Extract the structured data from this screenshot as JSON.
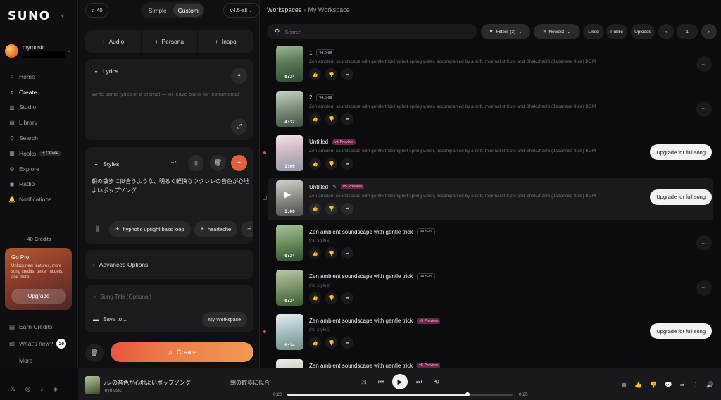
{
  "sidebar": {
    "logo": "SUNO",
    "user": {
      "name": "mymusic"
    },
    "nav": [
      {
        "label": "Home",
        "icon": "home-icon",
        "glyph": "⌂"
      },
      {
        "label": "Create",
        "icon": "music-note-icon",
        "glyph": "♫",
        "active": true
      },
      {
        "label": "Studio",
        "icon": "studio-icon",
        "glyph": "▥"
      },
      {
        "label": "Library",
        "icon": "library-icon",
        "glyph": "▤"
      },
      {
        "label": "Search",
        "icon": "search-icon",
        "glyph": "⚲"
      },
      {
        "label": "Hooks",
        "icon": "hooks-icon",
        "glyph": "▦",
        "badge": "+ Create"
      },
      {
        "label": "Explore",
        "icon": "explore-icon",
        "glyph": "◎"
      },
      {
        "label": "Radio",
        "icon": "radio-icon",
        "glyph": "◉"
      },
      {
        "label": "Notifications",
        "icon": "bell-icon",
        "glyph": "🔔"
      }
    ],
    "credits": "40 Credits",
    "gopro": {
      "title": "Go Pro",
      "desc": "Unlock new features, more song credits, better models, and more!",
      "button": "Upgrade"
    },
    "bottom": {
      "earn": "Earn Credits",
      "whats_new": "What's new?",
      "whats_new_count": "20",
      "more": "More"
    }
  },
  "create": {
    "credit_count": "40",
    "mode": {
      "simple": "Simple",
      "custom": "Custom"
    },
    "version": "v4.5-all",
    "add": {
      "audio": "Audio",
      "persona": "Persona",
      "inspo": "Inspo"
    },
    "lyrics": {
      "label": "Lyrics",
      "placeholder": "Write some lyrics or a prompt — or leave blank for instrumental"
    },
    "styles": {
      "label": "Styles",
      "text": "朝の散歩に似合うような、明るく軽快なウクレレの音色が心地よいポップソング",
      "tags": [
        "hypnotic upright bass loop",
        "heartache"
      ]
    },
    "advanced": "Advanced Options",
    "song_title_placeholder": "Song Title (Optional)",
    "save_to": "Save to...",
    "workspace_btn": "My Workspace",
    "create_btn": "Create"
  },
  "workspace": {
    "crumb_root": "Workspaces",
    "crumb_current": "My Workspace",
    "search_placeholder": "Search",
    "filters": "Filters (3)",
    "sort": "Newest",
    "liked": "Liked",
    "public": "Public",
    "uploads": "Uploads",
    "page": "1",
    "rows": [
      {
        "title": "1",
        "tag": "v4.5-all",
        "prev": false,
        "desc": "Zen ambient soundscape with gentle trickling hot spring water, accompanied by a soft, minimalist Koto and Shakuhachi (Japanese flute) BGM",
        "dur": "0:24",
        "action": "more",
        "dot": false
      },
      {
        "title": "2",
        "tag": "v4.5-all",
        "prev": false,
        "desc": "Zen ambient soundscape with gentle trickling hot spring water, accompanied by a soft, minimalist Koto and Shakuhachi (Japanese flute) BGM",
        "dur": "4:32",
        "action": "more",
        "dot": false
      },
      {
        "title": "Untitled",
        "tag": "v5 Preview",
        "prev": true,
        "desc": "Zen ambient soundscape with gentle trickling hot spring water, accompanied by a soft, minimalist Koto and Shakuhachi (Japanese flute) BGM",
        "dur": "1:00",
        "action": "upgrade",
        "dot": true
      },
      {
        "title": "Untitled",
        "tag": "v5 Preview",
        "prev": true,
        "desc": "Zen ambient soundscape with gentle trickling hot spring water, accompanied by a soft, minimalist Koto and Shakuhachi (Japanese flute) BGM",
        "dur": "1:00",
        "action": "upgrade",
        "dot": false,
        "highlight": true
      },
      {
        "title": "Zen ambient soundscape with gentle trick",
        "tag": "v4.5-all",
        "prev": false,
        "desc": "(no styles)",
        "dur": "0:24",
        "action": "more",
        "dot": false
      },
      {
        "title": "Zen ambient soundscape with gentle trick",
        "tag": "v4.5-all",
        "prev": false,
        "desc": "(no styles)",
        "dur": "0:24",
        "action": "more",
        "dot": false
      },
      {
        "title": "Zen ambient soundscape with gentle trick",
        "tag": "v5 Preview",
        "prev": true,
        "desc": "(no styles)",
        "dur": "0:34",
        "action": "upgrade",
        "dot": true
      },
      {
        "title": "Zen ambient soundscape with gentle trick",
        "tag": "v5 Preview",
        "prev": true,
        "desc": "",
        "dur": "",
        "action": "none",
        "dot": false
      }
    ],
    "upgrade_label": "Upgrade for full song"
  },
  "player": {
    "title": "♪レの音色が心地よいポップソング",
    "artist": "mymusic",
    "scroll_title": "朝の散歩に似合",
    "current": "0:20",
    "total": "0:25",
    "progress": 0.8
  },
  "colors": {
    "accent": "#ee6a45",
    "preview_tag": "#6c2448",
    "unread_dot": "#e0467a"
  }
}
